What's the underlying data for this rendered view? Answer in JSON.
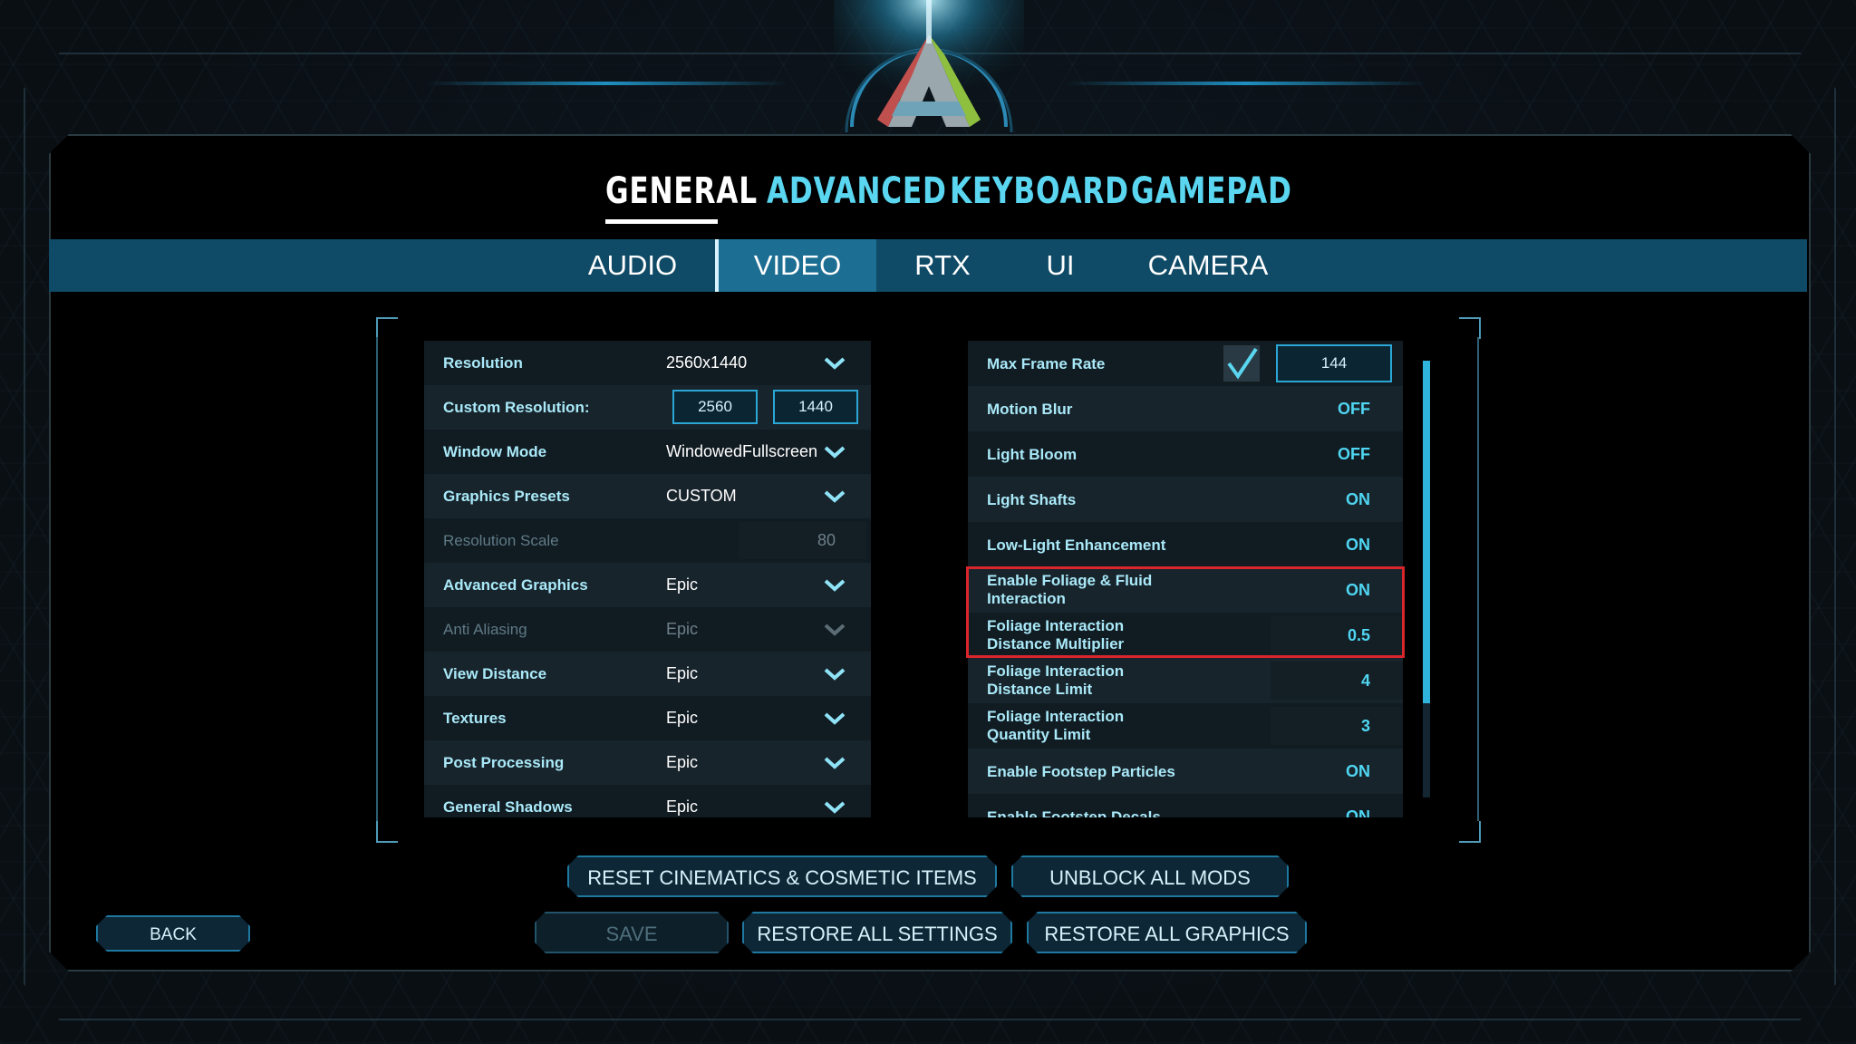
{
  "main_tabs": [
    {
      "label": "GENERAL",
      "active": true
    },
    {
      "label": "ADVANCED",
      "active": false
    },
    {
      "label": "KEYBOARD",
      "active": false
    },
    {
      "label": "GAMEPAD",
      "active": false
    }
  ],
  "sub_tabs": [
    {
      "label": "AUDIO",
      "active": false
    },
    {
      "label": "VIDEO",
      "active": true
    },
    {
      "label": "RTX",
      "active": false
    },
    {
      "label": "UI",
      "active": false
    },
    {
      "label": "CAMERA",
      "active": false
    }
  ],
  "left_settings": {
    "resolution": {
      "label": "Resolution",
      "value": "2560x1440"
    },
    "custom_resolution": {
      "label": "Custom Resolution:",
      "width": "2560",
      "height": "1440"
    },
    "window_mode": {
      "label": "Window Mode",
      "value": "WindowedFullscreen"
    },
    "graphics_presets": {
      "label": "Graphics Presets",
      "value": "CUSTOM"
    },
    "resolution_scale": {
      "label": "Resolution Scale",
      "value": "80"
    },
    "advanced_graphics": {
      "label": "Advanced Graphics",
      "value": "Epic"
    },
    "anti_aliasing": {
      "label": "Anti Aliasing",
      "value": "Epic"
    },
    "view_distance": {
      "label": "View Distance",
      "value": "Epic"
    },
    "textures": {
      "label": "Textures",
      "value": "Epic"
    },
    "post_processing": {
      "label": "Post Processing",
      "value": "Epic"
    },
    "general_shadows": {
      "label": "General Shadows",
      "value": "Epic"
    }
  },
  "right_settings": {
    "max_frame_rate": {
      "label": "Max Frame Rate",
      "value": "144",
      "checked": true
    },
    "motion_blur": {
      "label": "Motion Blur",
      "value": "OFF"
    },
    "light_bloom": {
      "label": "Light Bloom",
      "value": "OFF"
    },
    "light_shafts": {
      "label": "Light Shafts",
      "value": "ON"
    },
    "low_light": {
      "label": "Low-Light Enhancement",
      "value": "ON"
    },
    "foliage_fluid": {
      "label_1": "Enable Foliage & Fluid",
      "label_2": "Interaction",
      "value": "ON"
    },
    "foliage_multiplier": {
      "label_1": "Foliage Interaction",
      "label_2": "Distance Multiplier",
      "value": "0.5"
    },
    "foliage_limit": {
      "label_1": "Foliage Interaction",
      "label_2": "Distance Limit",
      "value": "4"
    },
    "foliage_quantity": {
      "label_1": "Foliage Interaction",
      "label_2": "Quantity Limit",
      "value": "3"
    },
    "footstep_particles": {
      "label": "Enable Footstep Particles",
      "value": "ON"
    },
    "footstep_decals": {
      "label": "Enable Footstep Decals",
      "value": "ON"
    }
  },
  "buttons": {
    "reset_cinematics": "RESET CINEMATICS & COSMETIC ITEMS",
    "unblock_mods": "UNBLOCK ALL MODS",
    "back": "BACK",
    "save": "SAVE",
    "restore_settings": "RESTORE ALL SETTINGS",
    "restore_graphics": "RESTORE ALL GRAPHICS"
  },
  "colors": {
    "accent": "#4fd6f2",
    "subbar": "#0f4a66",
    "sub_active": "#1c6e92",
    "highlight": "#d9252c"
  },
  "icons": [
    "game-logo-icon",
    "chevron-down-icon",
    "checkmark-icon"
  ]
}
